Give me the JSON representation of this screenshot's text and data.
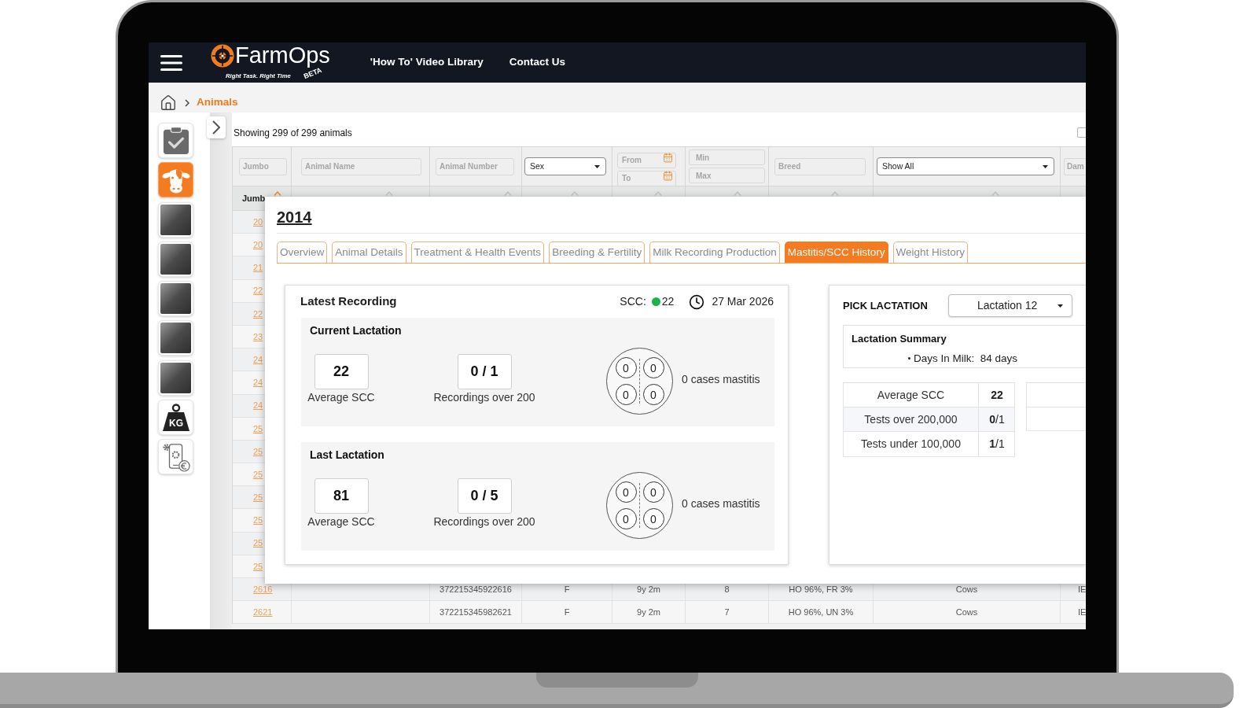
{
  "nav": {
    "logo": {
      "name": "FarmOps",
      "tagline": "Right Task. Right Time",
      "badge": "BETA"
    },
    "links": [
      "'How To' Video Library",
      "Contact Us"
    ]
  },
  "breadcrumb": {
    "current": "Animals"
  },
  "sidebar": {
    "items": [
      {
        "kind": "clipboard",
        "selected": false
      },
      {
        "kind": "cow",
        "selected": true
      },
      {
        "kind": "photo",
        "selected": false
      },
      {
        "kind": "photo",
        "selected": false
      },
      {
        "kind": "photo",
        "selected": false
      },
      {
        "kind": "photo",
        "selected": false
      },
      {
        "kind": "photo",
        "selected": false
      },
      {
        "kind": "weight",
        "label": "KG",
        "selected": false
      },
      {
        "kind": "phone",
        "selected": false
      }
    ]
  },
  "table": {
    "summary": "Showing 299 of 299 animals",
    "checkbox": {
      "checked": false
    },
    "filters": [
      {
        "kind": "text",
        "placeholder": "Jumbo"
      },
      {
        "kind": "text",
        "placeholder": "Animal Name"
      },
      {
        "kind": "text",
        "placeholder": "Animal Number"
      },
      {
        "kind": "select",
        "value": "Sex"
      },
      {
        "kind": "dates",
        "placeholders": [
          "From",
          "To"
        ]
      },
      {
        "kind": "range",
        "placeholders": [
          "Min",
          "Max"
        ]
      },
      {
        "kind": "text",
        "placeholder": "Breed"
      },
      {
        "kind": "select",
        "value": "Show All"
      },
      {
        "kind": "text",
        "placeholder": "Dam"
      }
    ],
    "columns": [
      {
        "label": "Jumb",
        "sorted": true
      },
      {
        "sorted": false
      },
      {
        "sorted": false
      },
      {
        "sorted": false
      },
      {
        "sorted": false
      },
      {
        "sorted": false
      },
      {
        "sorted": false
      },
      {
        "sorted": false
      }
    ],
    "rows": [
      {
        "jumbo": "20"
      },
      {
        "jumbo": "20"
      },
      {
        "jumbo": "21"
      },
      {
        "jumbo": "22"
      },
      {
        "jumbo": "22"
      },
      {
        "jumbo": "23"
      },
      {
        "jumbo": "24"
      },
      {
        "jumbo": "24"
      },
      {
        "jumbo": "24"
      },
      {
        "jumbo": "25"
      },
      {
        "jumbo": "25"
      },
      {
        "jumbo": "25"
      },
      {
        "jumbo": "25"
      },
      {
        "jumbo": "25"
      },
      {
        "jumbo": "25"
      },
      {
        "jumbo": "25"
      },
      {
        "jumbo": "2616",
        "animal_number": "372215345922616",
        "sex": "F",
        "column_5": "9y 2m",
        "column_6": "8",
        "breed": "HO 96%, FR 3%",
        "column_8": "Cows",
        "column_9": "IE"
      },
      {
        "jumbo": "2621",
        "animal_number": "372215345982621",
        "sex": "F",
        "column_5": "9y 2m",
        "column_6": "7",
        "breed": "HO 96%, UN 3%",
        "column_8": "Cows",
        "column_9": "IE"
      }
    ]
  },
  "animal_panel": {
    "title": "2014",
    "tabs": [
      {
        "label": "Overview",
        "selected": false
      },
      {
        "label": "Animal Details",
        "selected": false
      },
      {
        "label": "Treatment & Health Events",
        "selected": false
      },
      {
        "label": "Breeding & Fertility",
        "selected": false
      },
      {
        "label": "Milk Recording Production",
        "selected": false
      },
      {
        "label": "Mastitis/SCC History",
        "selected": true
      },
      {
        "label": "Weight History",
        "selected": false
      }
    ],
    "latest": {
      "title": "Latest Recording",
      "scc_label": "SCC:",
      "scc_high": false,
      "scc_value": "22",
      "date": "27 Mar 2026",
      "sections": [
        {
          "title": "Current Lactation",
          "stats": [
            {
              "value": "22",
              "label": "Average SCC"
            },
            {
              "value": "0 / 1",
              "label": "Recordings over 200"
            }
          ],
          "quarters": [
            "0",
            "0",
            "0",
            "0"
          ],
          "cases": "0 cases mastitis"
        },
        {
          "title": "Last Lactation",
          "stats": [
            {
              "value": "81",
              "label": "Average SCC"
            },
            {
              "value": "0 / 5",
              "label": "Recordings over 200"
            }
          ],
          "quarters": [
            "0",
            "0",
            "0",
            "0"
          ],
          "cases": "0 cases mastitis"
        }
      ]
    },
    "lactation": {
      "title": "PICK LACTATION",
      "value": "Lactation 12",
      "summary_title": "Lactation Summary",
      "summary_items": [
        "Days In Milk:  84 days"
      ],
      "stats": [
        {
          "label": "Average SCC",
          "value": "22"
        },
        {
          "label": "Tests over 200,000",
          "value": "0",
          "total": "/1"
        },
        {
          "label": "Tests under 100,000",
          "value": "1",
          "total": "/1"
        }
      ]
    }
  }
}
